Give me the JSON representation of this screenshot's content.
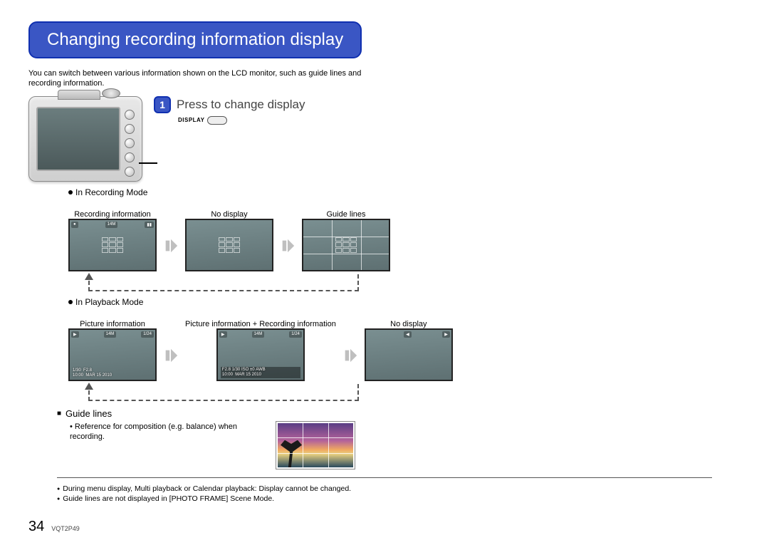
{
  "title": "Changing recording information display",
  "intro": "You can switch between various information shown on the LCD monitor, such as guide lines and recording information.",
  "step": {
    "num": "1",
    "title": "Press to change display",
    "button_label": "DISPLAY"
  },
  "recording_mode": {
    "heading": "In Recording Mode",
    "items": [
      "Recording information",
      "No display",
      "Guide lines"
    ]
  },
  "playback_mode": {
    "heading": "In Playback Mode",
    "items": [
      "Picture information",
      "Picture information + Recording information",
      "No display"
    ]
  },
  "guide_lines": {
    "heading": "Guide lines",
    "text": "Reference for composition (e.g. balance) when recording."
  },
  "notes": [
    "During menu display, Multi playback or Calendar playback: Display cannot be changed.",
    "Guide lines are not displayed in [PHOTO FRAME] Scene Mode."
  ],
  "page_number": "34",
  "doc_code": "VQT2P49"
}
